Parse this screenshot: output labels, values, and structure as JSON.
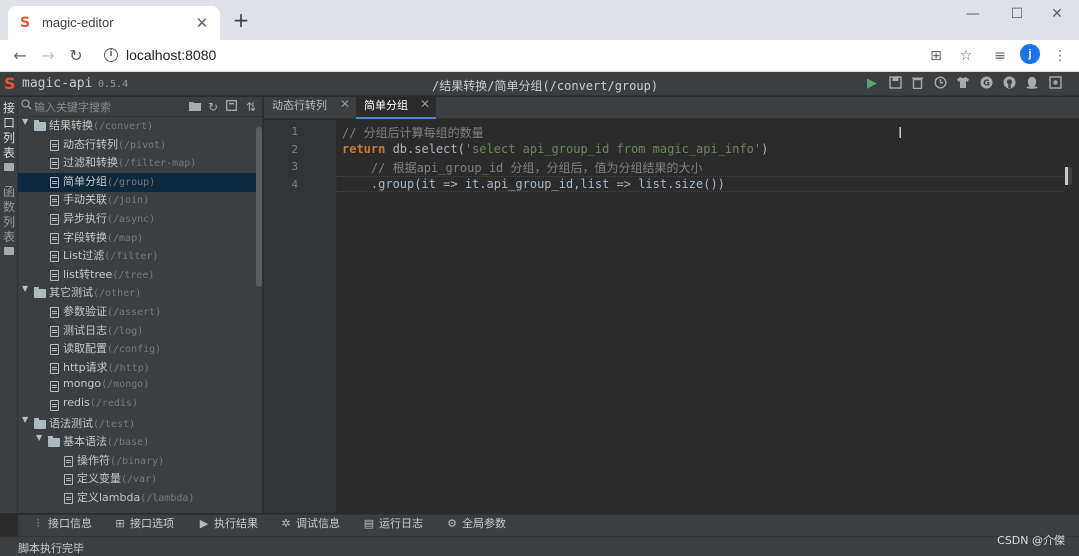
{
  "browser": {
    "tab_title": "magic-editor",
    "url": "localhost:8080",
    "profile_initial": "j",
    "colors": {
      "chrome_bg": "#dee1e6",
      "profile": "#1a73e8",
      "favicon": "#e8552b"
    }
  },
  "app": {
    "name": "magic-api",
    "version": "0.5.4",
    "current_path": "/结果转换/简单分组(/convert/group)",
    "header_icons": [
      "run-icon",
      "save-icon",
      "delete-icon",
      "history-icon",
      "skin-icon",
      "gitee-icon",
      "github-icon",
      "qq-icon",
      "settings-icon"
    ],
    "colors": {
      "run": "#59a869",
      "panel": "#3c3f41",
      "editor": "#2b2b2b",
      "selected": "#0d293e"
    }
  },
  "left_strip": {
    "api_list": [
      "接",
      "口",
      "列",
      "表"
    ],
    "function_list": [
      "函",
      "数",
      "列",
      "表"
    ]
  },
  "tree": {
    "search_placeholder": "输入关键字搜索",
    "tool_icons": [
      "new-folder-icon",
      "refresh-icon",
      "collapse-icon",
      "sort-icon"
    ],
    "items": [
      {
        "level": 0,
        "type": "folder",
        "expanded": true,
        "label": "结果转换",
        "path": "(/convert)"
      },
      {
        "level": 1,
        "type": "file",
        "label": "动态行转列",
        "path": "(/pivot)"
      },
      {
        "level": 1,
        "type": "file",
        "label": "过滤和转换",
        "path": "(/filter-map)"
      },
      {
        "level": 1,
        "type": "file",
        "label": "简单分组",
        "path": "(/group)",
        "selected": true
      },
      {
        "level": 1,
        "type": "file",
        "label": "手动关联",
        "path": "(/join)"
      },
      {
        "level": 1,
        "type": "file",
        "label": "异步执行",
        "path": "(/async)"
      },
      {
        "level": 1,
        "type": "file",
        "label": "字段转换",
        "path": "(/map)"
      },
      {
        "level": 1,
        "type": "file",
        "label": "List过滤",
        "path": "(/filter)"
      },
      {
        "level": 1,
        "type": "file",
        "label": "list转tree",
        "path": "(/tree)"
      },
      {
        "level": 0,
        "type": "folder",
        "expanded": true,
        "label": "其它测试",
        "path": "(/other)"
      },
      {
        "level": 1,
        "type": "file",
        "label": "参数验证",
        "path": "(/assert)"
      },
      {
        "level": 1,
        "type": "file",
        "label": "测试日志",
        "path": "(/log)"
      },
      {
        "level": 1,
        "type": "file",
        "label": "读取配置",
        "path": "(/config)"
      },
      {
        "level": 1,
        "type": "file",
        "label": "http请求",
        "path": "(/http)"
      },
      {
        "level": 1,
        "type": "file",
        "label": "mongo",
        "path": "(/mongo)"
      },
      {
        "level": 1,
        "type": "file",
        "label": "redis",
        "path": "(/redis)"
      },
      {
        "level": 0,
        "type": "folder",
        "expanded": true,
        "label": "语法测试",
        "path": "(/test)"
      },
      {
        "level": 1,
        "type": "folder",
        "expanded": true,
        "label": "基本语法",
        "path": "(/base)"
      },
      {
        "level": 2,
        "type": "file",
        "label": "操作符",
        "path": "(/binary)"
      },
      {
        "level": 2,
        "type": "file",
        "label": "定义变量",
        "path": "(/var)"
      },
      {
        "level": 2,
        "type": "file",
        "label": "定义lambda",
        "path": "(/lambda)"
      }
    ]
  },
  "editor": {
    "tabs": [
      {
        "label": "动态行转列",
        "active": false
      },
      {
        "label": "简单分组",
        "active": true
      }
    ],
    "lines": [
      {
        "number": "1",
        "tokens": [
          {
            "t": "// 分组后计算每组的数量",
            "c": "comment"
          }
        ]
      },
      {
        "number": "2",
        "tokens": [
          {
            "t": "return",
            "c": "keyword"
          },
          {
            "t": " db.select(",
            "c": "default"
          },
          {
            "t": "'select api_group_id from magic_api_info'",
            "c": "string"
          },
          {
            "t": ")",
            "c": "default"
          }
        ]
      },
      {
        "number": "3",
        "tokens": [
          {
            "t": "    // 根据api_group_id 分组，分组后，值为分组结果的大小",
            "c": "comment"
          }
        ]
      },
      {
        "number": "4",
        "tokens": [
          {
            "t": "    .group(it => it.api_group_id,list => list.size())",
            "c": "default"
          }
        ]
      }
    ],
    "token_colors": {
      "comment": "#808080",
      "keyword": "#cc7832",
      "string": "#6a8759",
      "default": "#a9b7c6"
    }
  },
  "bottom_panels": [
    {
      "icon": "api-info-icon",
      "label": "接口信息"
    },
    {
      "icon": "api-options-icon",
      "label": "接口选项"
    },
    {
      "icon": "play-icon",
      "label": "执行结果"
    },
    {
      "icon": "debug-icon",
      "label": "调试信息"
    },
    {
      "icon": "log-icon",
      "label": "运行日志"
    },
    {
      "icon": "gear-icon",
      "label": "全局参数"
    }
  ],
  "status": {
    "text": "脚本执行完毕",
    "watermark": "CSDN @介傑"
  }
}
